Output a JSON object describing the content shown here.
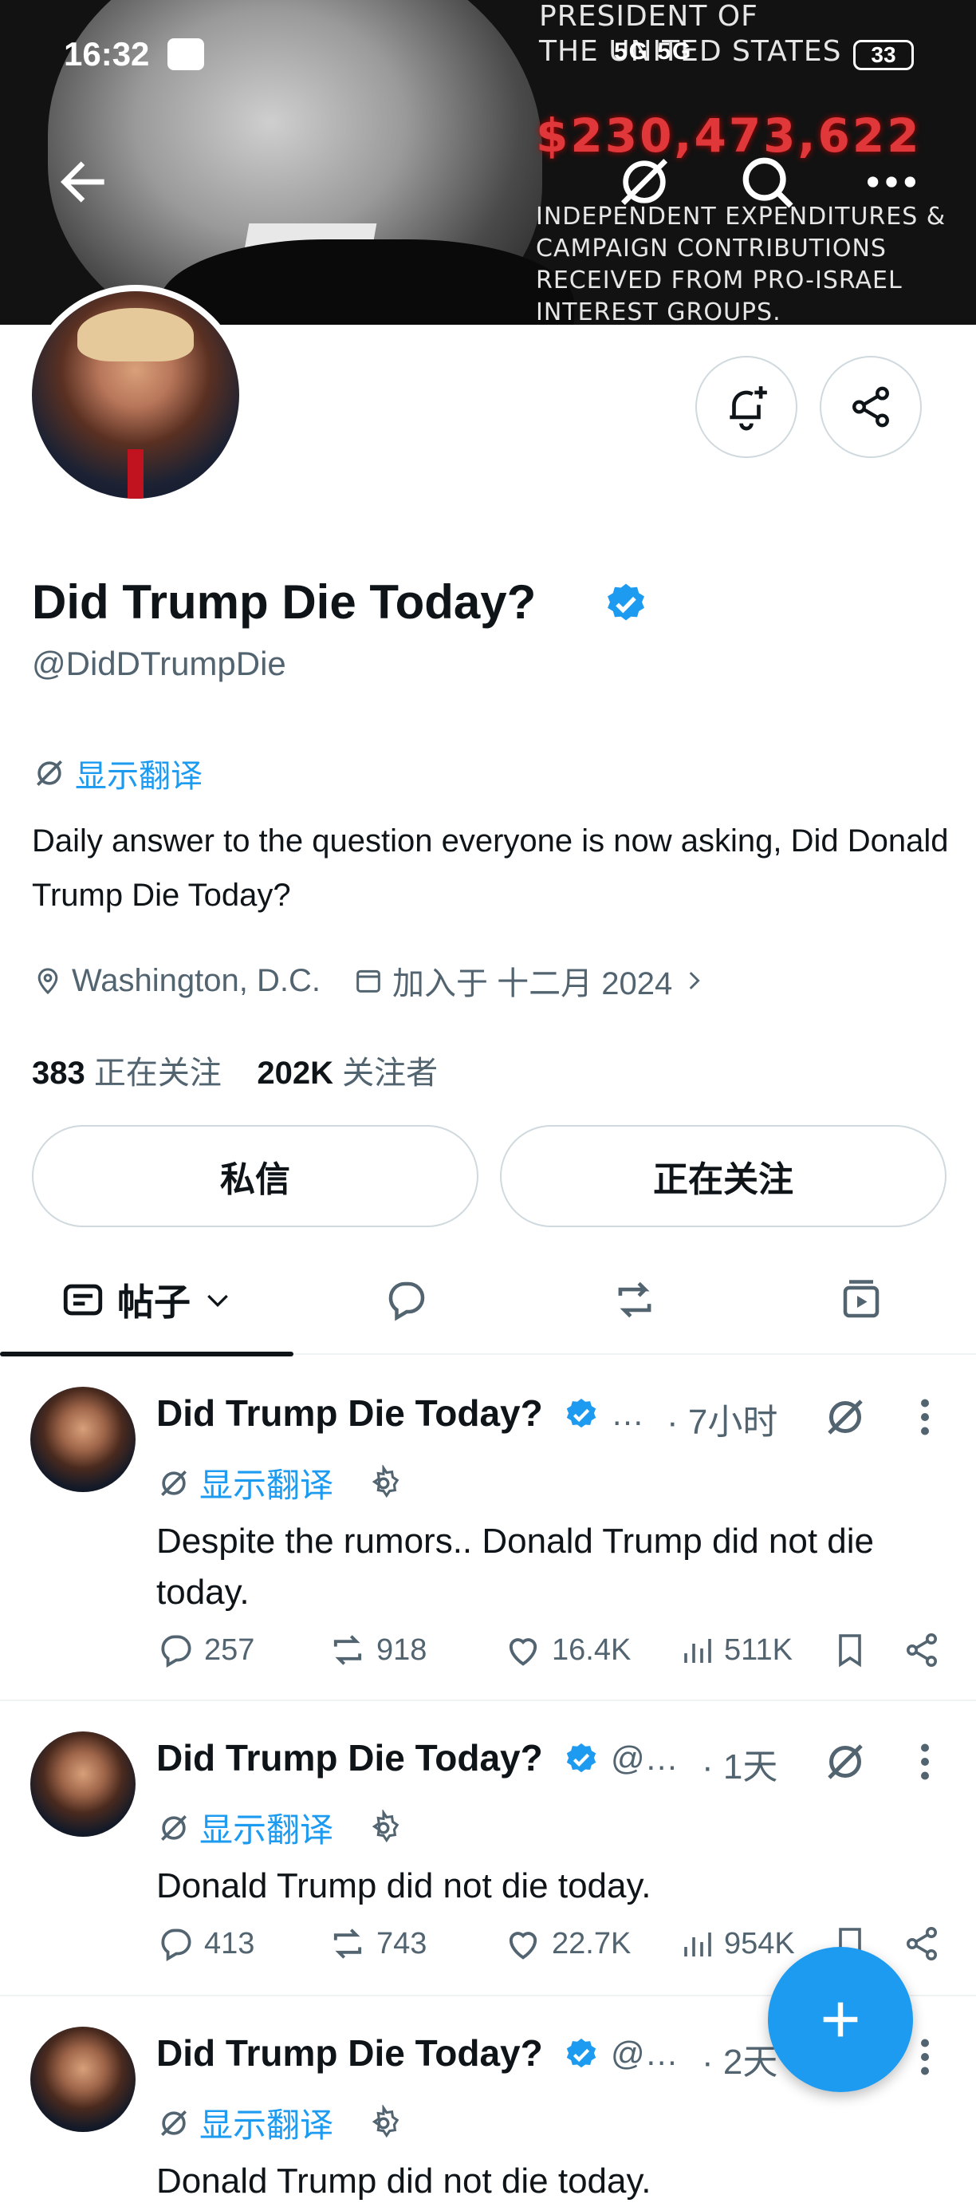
{
  "status_bar": {
    "time": "16:32",
    "network": "5G 5G",
    "battery": "33"
  },
  "banner": {
    "line1": "PRESIDENT OF",
    "line2": "THE UNITED STATES",
    "amount": "$230,473,622",
    "caption": "INDEPENDENT EXPENDITURES & CAMPAIGN CONTRIBUTIONS RECEIVED FROM PRO-ISRAEL INTEREST GROUPS."
  },
  "profile": {
    "name": "Did Trump Die Today?",
    "handle": "@DidDTrumpDie",
    "show_translation": "显示翻译",
    "bio": "Daily answer to the question everyone is now asking, Did Donald Trump Die Today?",
    "location": "Washington, D.C.",
    "joined": "加入于 十二月 2024",
    "following_count": "383",
    "following_label": "正在关注",
    "followers_count": "202K",
    "followers_label": "关注者"
  },
  "buttons": {
    "dm": "私信",
    "following": "正在关注"
  },
  "tabs": {
    "posts": "帖子"
  },
  "posts": [
    {
      "name": "Did Trump Die Today?",
      "handle": "…",
      "time": "· 7小时",
      "translate": "显示翻译",
      "text": "Despite the rumors.. Donald Trump did not die today.",
      "replies": "257",
      "reposts": "918",
      "likes": "16.4K",
      "views": "511K"
    },
    {
      "name": "Did Trump Die Today?",
      "handle": "@…",
      "time": "· 1天",
      "translate": "显示翻译",
      "text": "Donald Trump did not die today.",
      "replies": "413",
      "reposts": "743",
      "likes": "22.7K",
      "views": "954K"
    },
    {
      "name": "Did Trump Die Today?",
      "handle": "@…",
      "time": "· 2天",
      "translate": "显示翻译",
      "text": "Donald Trump did not die today."
    }
  ],
  "colors": {
    "accent": "#1d9bf0",
    "text": "#0f1419",
    "secondary": "#536471",
    "border": "#cfd9de"
  }
}
